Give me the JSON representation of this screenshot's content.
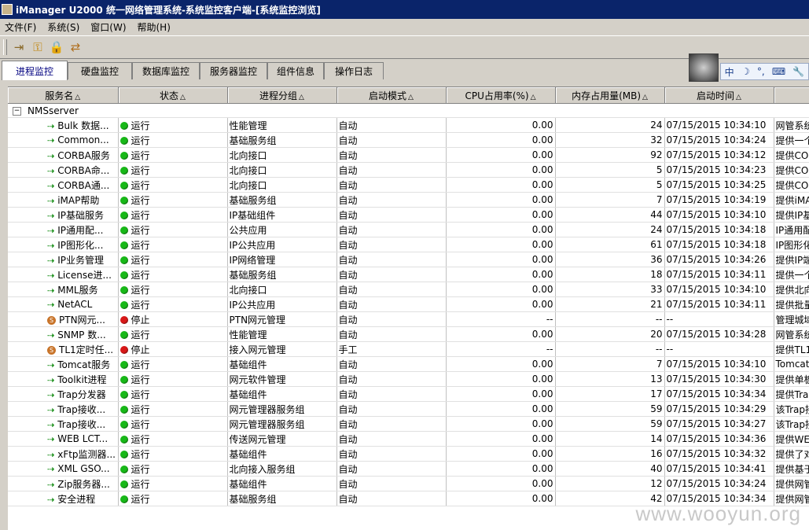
{
  "window": {
    "title": "iManager U2000 统一网络管理系统-系统监控客户端-[系统监控浏览]"
  },
  "menu": [
    "文件(F)",
    "系统(S)",
    "窗口(W)",
    "帮助(H)"
  ],
  "tabs": [
    "进程监控",
    "硬盘监控",
    "数据库监控",
    "服务器监控",
    "组件信息",
    "操作日志"
  ],
  "ime": {
    "mode": "中"
  },
  "columns": [
    "服务名",
    "状态",
    "进程分组",
    "启动模式",
    "CPU占用率(%)",
    "内存占用量(MB)",
    "启动时间",
    ""
  ],
  "group": "NMSserver",
  "colors": {
    "running": "#18b818",
    "stopped": "#d81818",
    "header_bg": "#d4d0c8",
    "title_bg": "#0a246a"
  },
  "rows": [
    [
      "Bulk 数据...",
      "running",
      "运行",
      "性能管理",
      "自动",
      "0.00",
      "24",
      "07/15/2015 10:34:10",
      "网管系统"
    ],
    [
      "Common...",
      "running",
      "运行",
      "基础服务组",
      "自动",
      "0.00",
      "32",
      "07/15/2015 10:34:24",
      "提供一个"
    ],
    [
      "CORBA服务",
      "running",
      "运行",
      "北向接口",
      "自动",
      "0.00",
      "92",
      "07/15/2015 10:34:12",
      "提供CO"
    ],
    [
      "CORBA命...",
      "running",
      "运行",
      "北向接口",
      "自动",
      "0.00",
      "5",
      "07/15/2015 10:34:23",
      "提供CO"
    ],
    [
      "CORBA通...",
      "running",
      "运行",
      "北向接口",
      "自动",
      "0.00",
      "5",
      "07/15/2015 10:34:25",
      "提供CO"
    ],
    [
      "iMAP帮助",
      "running",
      "运行",
      "基础服务组",
      "自动",
      "0.00",
      "7",
      "07/15/2015 10:34:19",
      "提供iMA"
    ],
    [
      "IP基础服务",
      "running",
      "运行",
      "IP基础组件",
      "自动",
      "0.00",
      "44",
      "07/15/2015 10:34:10",
      "提供IP基"
    ],
    [
      "IP通用配...",
      "running",
      "运行",
      "公共应用",
      "自动",
      "0.00",
      "24",
      "07/15/2015 10:34:18",
      "IP通用配"
    ],
    [
      "IP图形化...",
      "running",
      "运行",
      "IP公共应用",
      "自动",
      "0.00",
      "61",
      "07/15/2015 10:34:18",
      "IP图形化"
    ],
    [
      "IP业务管理",
      "running",
      "运行",
      "IP网络管理",
      "自动",
      "0.00",
      "36",
      "07/15/2015 10:34:26",
      "提供IP端"
    ],
    [
      "License进...",
      "running",
      "运行",
      "基础服务组",
      "自动",
      "0.00",
      "18",
      "07/15/2015 10:34:11",
      "提供一个"
    ],
    [
      "MML服务",
      "running",
      "运行",
      "北向接口",
      "自动",
      "0.00",
      "33",
      "07/15/2015 10:34:10",
      "提供北向"
    ],
    [
      "NetACL",
      "running",
      "运行",
      "IP公共应用",
      "自动",
      "0.00",
      "21",
      "07/15/2015 10:34:11",
      "提供批量"
    ],
    [
      "PTN网元...",
      "stopped",
      "停止",
      "PTN网元管理",
      "自动",
      "--",
      "--",
      "--",
      "管理城域"
    ],
    [
      "SNMP 数...",
      "running",
      "运行",
      "性能管理",
      "自动",
      "0.00",
      "20",
      "07/15/2015 10:34:28",
      "网管系统"
    ],
    [
      "TL1定时任...",
      "stopped",
      "停止",
      "接入网元管理",
      "手工",
      "--",
      "--",
      "--",
      "提供TL1"
    ],
    [
      "Tomcat服务",
      "running",
      "运行",
      "基础组件",
      "自动",
      "0.00",
      "7",
      "07/15/2015 10:34:10",
      "Tomcat"
    ],
    [
      "Toolkit进程",
      "running",
      "运行",
      "网元软件管理",
      "自动",
      "0.00",
      "13",
      "07/15/2015 10:34:30",
      "提供单板"
    ],
    [
      "Trap分发器",
      "running",
      "运行",
      "基础组件",
      "自动",
      "0.00",
      "17",
      "07/15/2015 10:34:34",
      "提供Tra"
    ],
    [
      "Trap接收...",
      "running",
      "运行",
      "网元管理器服务组",
      "自动",
      "0.00",
      "59",
      "07/15/2015 10:34:29",
      "该Trap接"
    ],
    [
      "Trap接收...",
      "running",
      "运行",
      "网元管理器服务组",
      "自动",
      "0.00",
      "59",
      "07/15/2015 10:34:27",
      "该Trap接"
    ],
    [
      "WEB LCT...",
      "running",
      "运行",
      "传送网元管理",
      "自动",
      "0.00",
      "14",
      "07/15/2015 10:34:36",
      "提供WE"
    ],
    [
      "xFtp监测器...",
      "running",
      "运行",
      "基础组件",
      "自动",
      "0.00",
      "16",
      "07/15/2015 10:34:32",
      "提供了对"
    ],
    [
      "XML GSO...",
      "running",
      "运行",
      "北向接入服务组",
      "自动",
      "0.00",
      "40",
      "07/15/2015 10:34:41",
      "提供基于"
    ],
    [
      "Zip服务器...",
      "running",
      "运行",
      "基础组件",
      "自动",
      "0.00",
      "12",
      "07/15/2015 10:34:24",
      "提供网管"
    ],
    [
      "安全进程",
      "running",
      "运行",
      "基础服务组",
      "自动",
      "0.00",
      "42",
      "07/15/2015 10:34:34",
      "提供网管"
    ]
  ],
  "watermark": "www.wooyun.org"
}
